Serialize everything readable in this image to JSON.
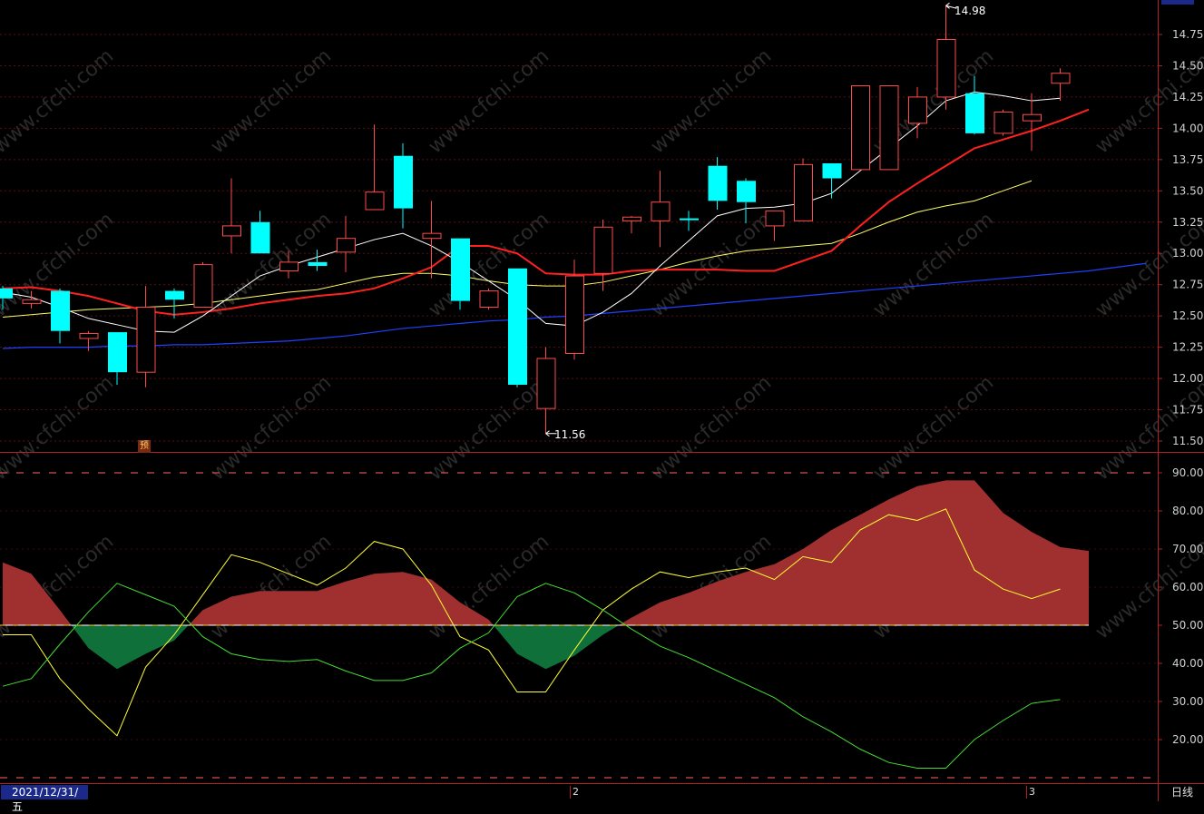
{
  "colors": {
    "background": "#000000",
    "up_candle": "#ff4a4a",
    "down_candle": "#00ffff",
    "ma5": "#ffffff",
    "ma10": "#ff2020",
    "ma20": "#ffff66",
    "ma60": "#2040ff",
    "axis": "#b22222",
    "osc_fill_up": "#a03030",
    "osc_fill_down": "#10703a",
    "osc_yellow": "#ffff33",
    "osc_green": "#44dd33"
  },
  "footer": {
    "date_label": "2021/12/31/五",
    "timeframe": "日线",
    "month_marks": [
      "2",
      "3"
    ]
  },
  "annotations": {
    "high_label": "14.98",
    "low_label": "11.56",
    "forecast_tag": "预",
    "watermark": "www.cfchi.com"
  },
  "chart_data": [
    {
      "type": "candlestick",
      "ylim": [
        11.5,
        15.0
      ],
      "y_ticks": [
        "11.50",
        "11.75",
        "12.00",
        "12.25",
        "12.50",
        "12.75",
        "13.00",
        "13.25",
        "13.50",
        "13.75",
        "14.00",
        "14.25",
        "14.50",
        "14.75"
      ],
      "candles": [
        {
          "o": 12.72,
          "h": 12.74,
          "l": 12.55,
          "c": 12.64
        },
        {
          "o": 12.6,
          "h": 12.7,
          "l": 12.56,
          "c": 12.63
        },
        {
          "o": 12.7,
          "h": 12.72,
          "l": 12.28,
          "c": 12.38
        },
        {
          "o": 12.32,
          "h": 12.38,
          "l": 12.22,
          "c": 12.36
        },
        {
          "o": 12.37,
          "h": 12.37,
          "l": 11.95,
          "c": 12.05
        },
        {
          "o": 12.05,
          "h": 12.74,
          "l": 11.93,
          "c": 12.57
        },
        {
          "o": 12.7,
          "h": 12.72,
          "l": 12.48,
          "c": 12.63
        },
        {
          "o": 12.57,
          "h": 12.93,
          "l": 12.57,
          "c": 12.91
        },
        {
          "o": 13.14,
          "h": 13.6,
          "l": 13.0,
          "c": 13.22
        },
        {
          "o": 13.25,
          "h": 13.34,
          "l": 13.0,
          "c": 13.0
        },
        {
          "o": 12.86,
          "h": 13.02,
          "l": 12.8,
          "c": 12.93
        },
        {
          "o": 12.93,
          "h": 13.03,
          "l": 12.86,
          "c": 12.9
        },
        {
          "o": 13.01,
          "h": 13.3,
          "l": 12.85,
          "c": 13.12
        },
        {
          "o": 13.35,
          "h": 14.03,
          "l": 13.35,
          "c": 13.49
        },
        {
          "o": 13.78,
          "h": 13.88,
          "l": 13.2,
          "c": 13.36
        },
        {
          "o": 13.12,
          "h": 13.42,
          "l": 12.8,
          "c": 13.16
        },
        {
          "o": 13.12,
          "h": 13.12,
          "l": 12.55,
          "c": 12.62
        },
        {
          "o": 12.57,
          "h": 12.72,
          "l": 12.55,
          "c": 12.7
        },
        {
          "o": 12.88,
          "h": 12.88,
          "l": 11.93,
          "c": 11.95
        },
        {
          "o": 11.76,
          "h": 12.25,
          "l": 11.56,
          "c": 12.16
        },
        {
          "o": 12.2,
          "h": 12.95,
          "l": 12.15,
          "c": 12.82
        },
        {
          "o": 12.84,
          "h": 13.27,
          "l": 12.7,
          "c": 13.21
        },
        {
          "o": 13.26,
          "h": 13.3,
          "l": 13.16,
          "c": 13.29
        },
        {
          "o": 13.26,
          "h": 13.66,
          "l": 13.05,
          "c": 13.41
        },
        {
          "o": 13.28,
          "h": 13.34,
          "l": 13.18,
          "c": 13.27
        },
        {
          "o": 13.7,
          "h": 13.77,
          "l": 13.35,
          "c": 13.42
        },
        {
          "o": 13.58,
          "h": 13.6,
          "l": 13.24,
          "c": 13.41
        },
        {
          "o": 13.22,
          "h": 13.34,
          "l": 13.1,
          "c": 13.34
        },
        {
          "o": 13.26,
          "h": 13.76,
          "l": 13.26,
          "c": 13.71
        },
        {
          "o": 13.72,
          "h": 13.72,
          "l": 13.44,
          "c": 13.6
        },
        {
          "o": 13.67,
          "h": 14.34,
          "l": 13.67,
          "c": 14.34
        },
        {
          "o": 13.67,
          "h": 14.34,
          "l": 13.67,
          "c": 14.34
        },
        {
          "o": 14.04,
          "h": 14.33,
          "l": 13.92,
          "c": 14.25
        },
        {
          "o": 14.25,
          "h": 14.98,
          "l": 14.15,
          "c": 14.71
        },
        {
          "o": 14.28,
          "h": 14.42,
          "l": 13.95,
          "c": 13.96
        },
        {
          "o": 13.96,
          "h": 14.15,
          "l": 13.94,
          "c": 14.13
        },
        {
          "o": 14.06,
          "h": 14.28,
          "l": 13.82,
          "c": 14.11
        },
        {
          "o": 14.36,
          "h": 14.48,
          "l": 14.22,
          "c": 14.44
        }
      ],
      "ma5": [
        12.69,
        12.65,
        12.57,
        12.48,
        12.43,
        12.38,
        12.37,
        12.5,
        12.66,
        12.82,
        12.9,
        12.97,
        13.04,
        13.11,
        13.16,
        13.06,
        12.93,
        12.78,
        12.63,
        12.44,
        12.42,
        12.53,
        12.68,
        12.9,
        13.1,
        13.3,
        13.36,
        13.37,
        13.4,
        13.48,
        13.66,
        13.84,
        14.02,
        14.22,
        14.29,
        14.26,
        14.22,
        14.24
      ],
      "ma10": [
        12.72,
        12.73,
        12.7,
        12.66,
        12.6,
        12.54,
        12.51,
        12.53,
        12.56,
        12.6,
        12.63,
        12.66,
        12.68,
        12.72,
        12.8,
        12.89,
        13.06,
        13.06,
        13.0,
        12.84,
        12.83,
        12.83,
        12.86,
        12.87,
        12.87,
        12.87,
        12.86,
        12.86,
        12.94,
        13.02,
        13.22,
        13.41,
        13.56,
        13.7,
        13.84,
        13.91,
        13.98,
        14.06,
        14.15
      ],
      "ma20": [
        12.49,
        12.51,
        12.53,
        12.55,
        12.56,
        12.57,
        12.58,
        12.6,
        12.63,
        12.66,
        12.69,
        12.71,
        12.76,
        12.81,
        12.84,
        12.84,
        12.82,
        12.78,
        12.75,
        12.74,
        12.74,
        12.77,
        12.82,
        12.87,
        12.93,
        12.98,
        13.02,
        13.04,
        13.06,
        13.08,
        13.16,
        13.25,
        13.33,
        13.38,
        13.42,
        13.5,
        13.58
      ],
      "ma60": [
        12.24,
        12.25,
        12.25,
        12.25,
        12.26,
        12.26,
        12.27,
        12.27,
        12.28,
        12.29,
        12.3,
        12.32,
        12.34,
        12.37,
        12.4,
        12.42,
        12.44,
        12.46,
        12.47,
        12.49,
        12.5,
        12.52,
        12.54,
        12.56,
        12.58,
        12.6,
        12.62,
        12.64,
        12.66,
        12.68,
        12.7,
        12.72,
        12.74,
        12.76,
        12.78,
        12.8,
        12.82,
        12.84,
        12.86,
        12.89,
        12.92
      ]
    },
    {
      "type": "area",
      "ylim": [
        10,
        92
      ],
      "y_ticks": [
        "20.00",
        "30.00",
        "40.00",
        "50.00",
        "60.00",
        "70.00",
        "80.00",
        "90.00"
      ],
      "baseline": 50,
      "dashed_levels": [
        90,
        10
      ],
      "filled_line": [
        66.5,
        63.5,
        54,
        44,
        38.5,
        42.5,
        46,
        54,
        57.5,
        59,
        59,
        59,
        61.5,
        63.5,
        64,
        62,
        56,
        51.5,
        42.5,
        38.5,
        42,
        47.5,
        52,
        56,
        58.5,
        61.5,
        64,
        66,
        70,
        75,
        79,
        83,
        86.5,
        88,
        88,
        79.5,
        74.5,
        70.5,
        69.5
      ],
      "yellow_line": [
        47.5,
        47.5,
        36,
        28,
        21,
        39,
        47.5,
        58,
        68.5,
        66.5,
        63.5,
        60.5,
        65,
        72,
        70,
        60.5,
        47,
        43.5,
        32.5,
        32.5,
        43.5,
        54,
        59.5,
        64,
        62.5,
        64,
        65,
        62,
        68,
        66.5,
        75,
        79,
        77.5,
        80.5,
        64.5,
        59.5,
        57,
        59.5
      ],
      "green_line": [
        34,
        36,
        45,
        53.5,
        61,
        58,
        55,
        47,
        42.5,
        41,
        40.5,
        41,
        38,
        35.5,
        35.5,
        37.5,
        44,
        48,
        57.5,
        61,
        58.5,
        54,
        49,
        44.5,
        41.5,
        38,
        34.5,
        31,
        26,
        22,
        17.5,
        14,
        12.5,
        12.5,
        20,
        25,
        29.5,
        30.5
      ]
    }
  ]
}
